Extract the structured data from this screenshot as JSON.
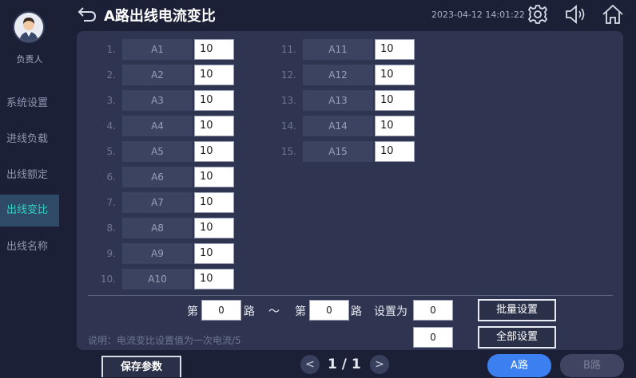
{
  "header": {
    "title": "A路出线电流变比",
    "time": "2023-04-12 14:01:22"
  },
  "user": {
    "role": "负责人"
  },
  "sidebar": {
    "items": [
      {
        "label": "系统设置"
      },
      {
        "label": "进线负载"
      },
      {
        "label": "出线额定"
      },
      {
        "label": "出线变比"
      },
      {
        "label": "出线名称"
      }
    ]
  },
  "lines": [
    {
      "num": "1.",
      "label": "A1",
      "value": "10"
    },
    {
      "num": "2.",
      "label": "A2",
      "value": "10"
    },
    {
      "num": "3.",
      "label": "A3",
      "value": "10"
    },
    {
      "num": "4.",
      "label": "A4",
      "value": "10"
    },
    {
      "num": "5.",
      "label": "A5",
      "value": "10"
    },
    {
      "num": "6.",
      "label": "A6",
      "value": "10"
    },
    {
      "num": "7.",
      "label": "A7",
      "value": "10"
    },
    {
      "num": "8.",
      "label": "A8",
      "value": "10"
    },
    {
      "num": "9.",
      "label": "A9",
      "value": "10"
    },
    {
      "num": "10.",
      "label": "A10",
      "value": "10"
    },
    {
      "num": "11.",
      "label": "A11",
      "value": "10"
    },
    {
      "num": "12.",
      "label": "A12",
      "value": "10"
    },
    {
      "num": "13.",
      "label": "A13",
      "value": "10"
    },
    {
      "num": "14.",
      "label": "A14",
      "value": "10"
    },
    {
      "num": "15.",
      "label": "A15",
      "value": "10"
    }
  ],
  "batch": {
    "prefix_from": "第",
    "from_value": "0",
    "suffix_from": "路",
    "tilde": "～",
    "prefix_to": "第",
    "to_value": "0",
    "suffix_to": "路",
    "set_to_label": "设置为",
    "set_value": "0",
    "batch_button": "批量设置",
    "all_value": "0",
    "all_button": "全部设置",
    "note": "说明：电流变比设置值为一次电流/5"
  },
  "footer": {
    "save_button": "保存参数",
    "prev": "<",
    "page": "1 / 1",
    "next": ">",
    "tab_a": "A路",
    "tab_b": "B路"
  }
}
